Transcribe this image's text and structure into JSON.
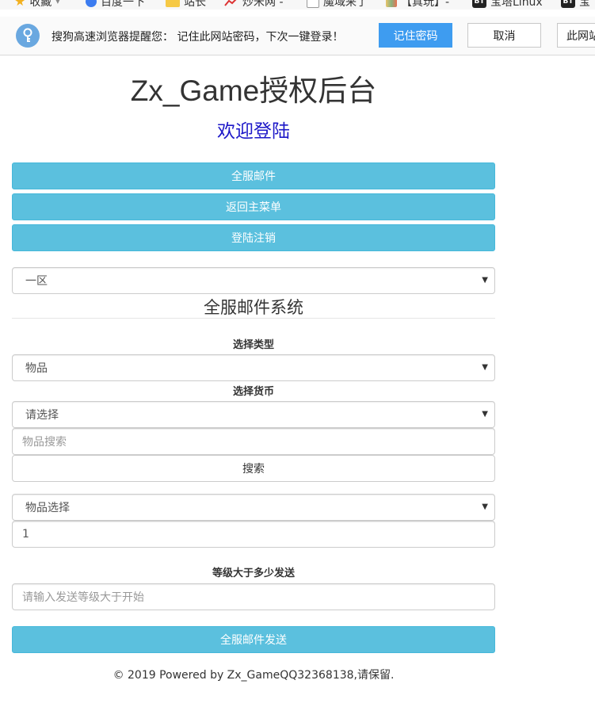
{
  "browser": {
    "bookmarks": [
      {
        "label": "收藏",
        "icon": "star-icon"
      },
      {
        "label": "百度一下",
        "icon": "baidu-paw-icon"
      },
      {
        "label": "站长",
        "icon": "folder-icon"
      },
      {
        "label": "炒米网 -",
        "icon": "trend-chart-icon"
      },
      {
        "label": "魔域来了",
        "icon": "page-icon"
      },
      {
        "label": "【真玩】-",
        "icon": "colorful-tile-icon"
      },
      {
        "label": "宝塔Linux",
        "icon": "bt-logo-icon"
      },
      {
        "label": "宝",
        "icon": "bt-logo-icon"
      }
    ],
    "bt_badge": "BT",
    "password_prompt": {
      "message": "搜狗高速浏览器提醒您： 记住此网站密码，下次一键登录！",
      "remember_label": "记住密码",
      "cancel_label": "取消",
      "never_label": "此网站"
    }
  },
  "page": {
    "title": "Zx_Game授权后台",
    "welcome": "欢迎登陆",
    "nav_buttons": [
      "全服邮件",
      "返回主菜单",
      "登陆注销"
    ],
    "server_select": "一区",
    "section_title": "全服邮件系统",
    "type_label": "选择类型",
    "type_select": "物品",
    "currency_label": "选择货币",
    "currency_select": "请选择",
    "item_search_placeholder": "物品搜索",
    "search_button": "搜索",
    "item_select": "物品选择",
    "quantity_value": "1",
    "level_label": "等级大于多少发送",
    "level_placeholder": "请输入发送等级大于开始",
    "send_button": "全服邮件发送",
    "footer": "© 2019 Powered by Zx_GameQQ32368138,请保留."
  },
  "colors": {
    "info_button": "#5bc0de",
    "welcome_text": "#1d18c8",
    "remember_button": "#3e9cf0"
  }
}
